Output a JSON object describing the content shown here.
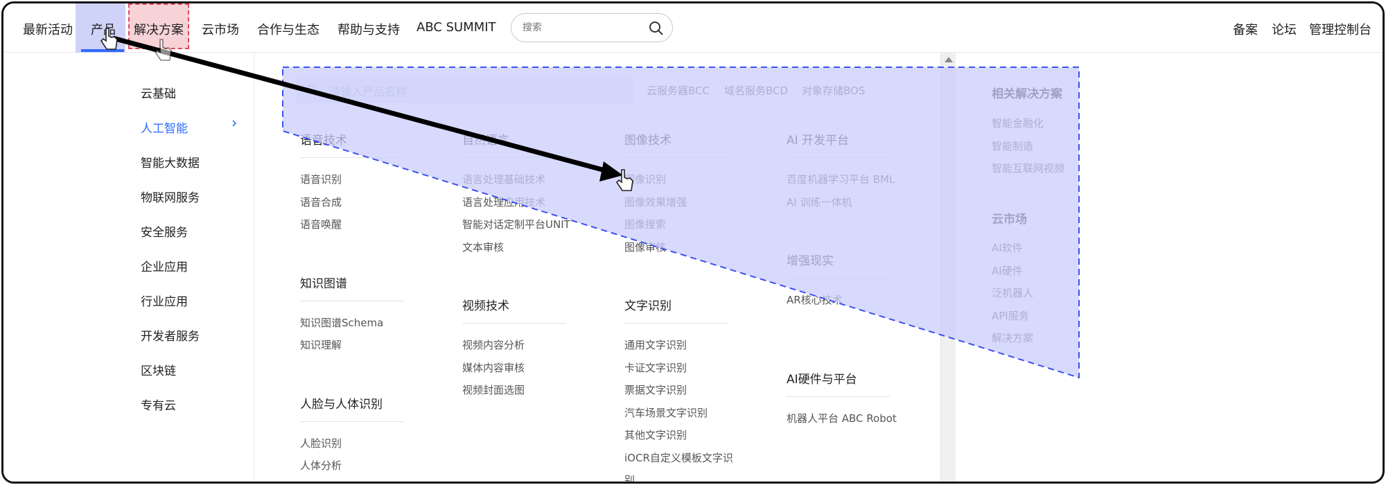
{
  "nav": {
    "items": [
      "最新活动",
      "产品",
      "解决方案",
      "云市场",
      "合作与生态",
      "帮助与支持",
      "ABC SUMMIT"
    ],
    "search_placeholder": "搜索",
    "right_items": [
      "备案",
      "论坛",
      "管理控制台"
    ]
  },
  "categories": {
    "items": [
      "云基础",
      "人工智能",
      "智能大数据",
      "物联网服务",
      "安全服务",
      "企业应用",
      "行业应用",
      "开发者服务",
      "区块链",
      "专有云"
    ],
    "active_index": 1
  },
  "product_search": {
    "placeholder": "请输入产品名称",
    "quick_links": [
      "云服务器BCC",
      "域名服务BCD",
      "对象存储BOS"
    ]
  },
  "groups": {
    "speech": {
      "title": "语音技术",
      "links": [
        "语音识别",
        "语音合成",
        "语音唤醒"
      ]
    },
    "knowledge": {
      "title": "知识图谱",
      "links": [
        "知识图谱Schema",
        "知识理解"
      ]
    },
    "face": {
      "title": "人脸与人体识别",
      "links": [
        "人脸识别",
        "人体分析"
      ]
    },
    "nlp": {
      "title": "自然语言",
      "links": [
        "语言处理基础技术",
        "语言处理应用技术",
        "智能对话定制平台UNIT",
        "文本审核"
      ]
    },
    "video": {
      "title": "视频技术",
      "links": [
        "视频内容分析",
        "媒体内容审核",
        "视频封面选图"
      ]
    },
    "image": {
      "title": "图像技术",
      "links": [
        "图像识别",
        "图像效果增强",
        "图像搜索",
        "图像审核"
      ]
    },
    "ocr": {
      "title": "文字识别",
      "links": [
        "通用文字识别",
        "卡证文字识别",
        "票据文字识别",
        "汽车场景文字识别",
        "其他文字识别",
        "iOCR自定义模板文字识",
        "别"
      ]
    },
    "ai_platform": {
      "title": "AI 开发平台",
      "links": [
        "百度机器学习平台 BML",
        "AI 训练一体机"
      ]
    },
    "ar": {
      "title": "增强现实",
      "links": [
        "AR核心技术"
      ]
    },
    "hardware": {
      "title": "AI硬件与平台",
      "links": [
        "机器人平台 ABC Robot"
      ]
    }
  },
  "right": {
    "solutions_title": "相关解决方案",
    "solutions": [
      "智能金融化",
      "智能制造",
      "智能互联网视频"
    ],
    "market_title": "云市场",
    "market": [
      "AI软件",
      "AI硬件",
      "泛机器人",
      "API服务",
      "解决方案"
    ]
  },
  "colors": {
    "accent": "#2f6bff",
    "overlay_fill": "#c9cdfb",
    "overlay_stroke": "#3b4ff0",
    "highlight_red": "#e04a58"
  },
  "icons": [
    "search-icon",
    "chevron-right-icon",
    "hand-cursor-icon",
    "drag-arrow"
  ]
}
